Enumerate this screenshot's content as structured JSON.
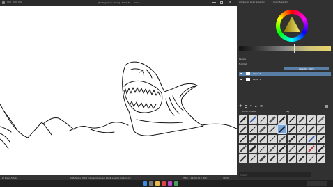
{
  "window": {
    "title": "[Multi-gesture shark] - 8467.68 — Krita"
  },
  "dockers": {
    "tabs": [
      "Advanced Color Selector",
      "Color Selector"
    ],
    "layers_label": "Layers",
    "blend_mode": "Normal",
    "opacity": "Opacity: 100%",
    "layers": [
      {
        "name": "Layer 2",
        "selected": true
      },
      {
        "name": "Layer 1",
        "selected": false
      }
    ],
    "presets_title": "Brush Presets",
    "presets_tag": "Tag",
    "presets_search_placeholder": "Search"
  },
  "status": {
    "left": "b) Basic-5 Size",
    "center": "RGB/Alpha (8-bit integer/channel) sRGB-elle-V2-srgbtrc.icc",
    "right": "2560 x 1440 (18.2 MiB)",
    "zoom": "100%"
  },
  "colors": {
    "accent": "#5a7fa6",
    "canvas": "#ffffff",
    "panel": "#313131"
  },
  "taskbar": {
    "icons": [
      "windows-icon",
      "search-icon",
      "files-icon",
      "browser-icon",
      "krita-icon",
      "media-icon"
    ]
  }
}
